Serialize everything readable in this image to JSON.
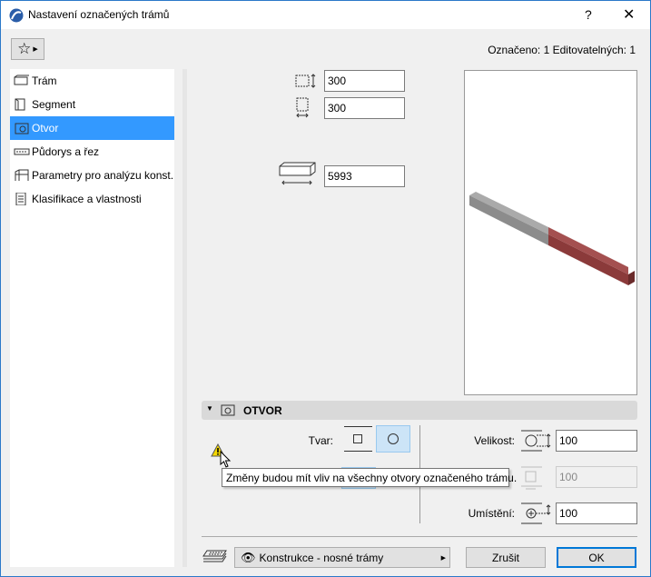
{
  "window": {
    "title": "Nastavení označených trámů",
    "help": "?",
    "close": "✕"
  },
  "header": {
    "selection_info": "Označeno: 1 Editovatelných: 1"
  },
  "sidebar": {
    "items": [
      {
        "label": "Trám",
        "icon": "beam-icon"
      },
      {
        "label": "Segment",
        "icon": "segment-icon"
      },
      {
        "label": "Otvor",
        "icon": "hole-icon",
        "selected": true
      },
      {
        "label": "Půdorys a řez",
        "icon": "floorplan-icon"
      },
      {
        "label": "Parametry pro analýzu konst...",
        "icon": "analysis-icon"
      },
      {
        "label": "Klasifikace a vlastnosti",
        "icon": "classification-icon"
      }
    ]
  },
  "geometry": {
    "height": "300",
    "width": "300",
    "length": "5993"
  },
  "section": {
    "title": "OTVOR",
    "shape_label": "Tvar:",
    "shape_options": [
      "square",
      "circle"
    ],
    "shape_selected": "circle",
    "size_label": "Velikost:",
    "size": "100",
    "size2": "100",
    "placement_label": "Umístění:",
    "placement": "100"
  },
  "tooltip": "Změny budou mít vliv na všechny otvory označeného trámu.",
  "footer": {
    "layer": "Konstrukce - nosné trámy",
    "cancel": "Zrušit",
    "ok": "OK"
  },
  "colors": {
    "accent": "#3399ff",
    "beam_gray": "#8c8c8c",
    "beam_red": "#8b3a3a"
  }
}
